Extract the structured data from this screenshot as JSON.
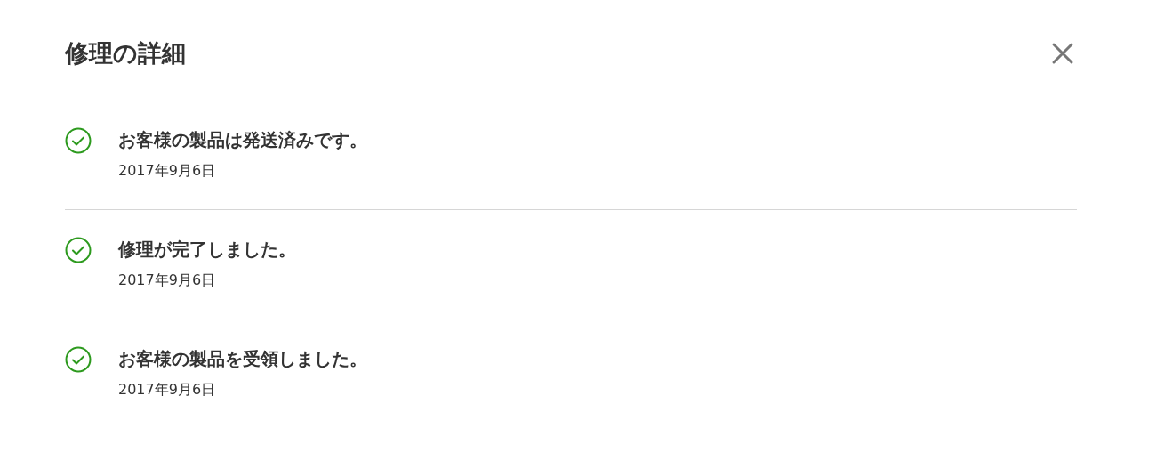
{
  "dialog": {
    "title": "修理の詳細"
  },
  "events": [
    {
      "label": "お客様の製品は発送済みです。",
      "date": "2017年9月6日"
    },
    {
      "label": "修理が完了しました。",
      "date": "2017年9月6日"
    },
    {
      "label": "お客様の製品を受領しました。",
      "date": "2017年9月6日"
    }
  ]
}
